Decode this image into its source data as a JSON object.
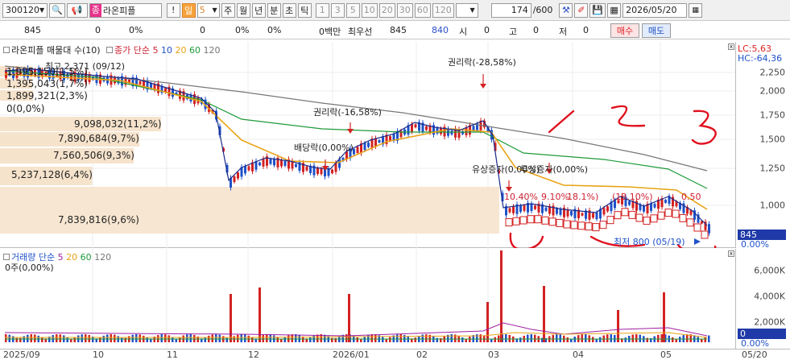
{
  "toolbar": {
    "code": "300120",
    "stock_tag": "종",
    "stock_name": "라온피플",
    "exclaim": "!",
    "period_sel": "일",
    "period_num": "5",
    "periods": [
      "주",
      "월",
      "년",
      "분",
      "초",
      "틱"
    ],
    "intervals": [
      "1",
      "3",
      "5",
      "10",
      "20",
      "30",
      "60",
      "120"
    ],
    "count": "174",
    "count_total": "/600",
    "date": "2026/05/20"
  },
  "quote": {
    "v1": "845",
    "v2": "0",
    "v3": "0%",
    "v4": "0",
    "v5": "0%",
    "v6": "0%",
    "money": "0백만",
    "best_label": "최우선",
    "best1": "845",
    "best2": "840",
    "o_label": "시",
    "o": "0",
    "h_label": "고",
    "h": "0",
    "l_label": "저",
    "l": "0",
    "buy": "매수",
    "sell": "매도"
  },
  "price_pane": {
    "legend_main": "라온피플 매물대 수(10)",
    "legend_ma": "종가 단순",
    "ma_periods": [
      "5",
      "10",
      "20",
      "60",
      "120"
    ],
    "lc": "LC:5,63",
    "hc": "HC:-64,36",
    "high_label": "최고 2,371 (09/12)",
    "low_label": "최저 800 (05/19)",
    "ann_rights1": "권리락(-28,58%)",
    "ann_rights2": "권리락(-16,58%)",
    "ann_div": "배당락(0,00%)",
    "ann_cap": "유상증자(0,00%)",
    "ann_bonus": "무상증자(0,00%)",
    "b_label_1": "10.40%",
    "b_label_2": "9.10%",
    "b_label_3": "18.1%)",
    "b_label_4": "(13.10%)",
    "b_label_5": "0.50",
    "price_last": "845",
    "price_pct": "0.00%",
    "y_ticks": [
      "2,250",
      "2,000",
      "1,750",
      "1,500",
      "1,250",
      "1,000"
    ],
    "volume_profile": [
      {
        "label": "1,995,150(1,5%)",
        "value": 1995150,
        "pct": 1.5
      },
      {
        "label": "1,395,043(1,7%)",
        "value": 1395043,
        "pct": 1.7
      },
      {
        "label": "1,899,321(2,3%)",
        "value": 1899321,
        "pct": 2.3
      },
      {
        "label": "0(0,0%)",
        "value": 0,
        "pct": 0.0
      },
      {
        "label": "9,098,032(11,2%)",
        "value": 9098032,
        "pct": 11.2
      },
      {
        "label": "7,890,684(9,7%)",
        "value": 7890684,
        "pct": 9.7
      },
      {
        "label": "7,560,506(9,3%)",
        "value": 7560506,
        "pct": 9.3
      },
      {
        "label": "5,237,128(6,4%)",
        "value": 5237128,
        "pct": 6.4
      },
      {
        "label": "7,839,816(9,6%)",
        "value": 7839816,
        "pct": 9.6
      }
    ]
  },
  "volume_pane": {
    "legend_main": "거래량",
    "legend_ma": "단순",
    "ma_periods": [
      "5",
      "20",
      "60",
      "120"
    ],
    "readout": "0주(0,00%)",
    "y_ticks": [
      "6,000K",
      "4,000K",
      "2,000K"
    ],
    "last": "0",
    "last_pct": "0.00%"
  },
  "x_axis": {
    "labels": [
      "2025/09",
      "10",
      "11",
      "12",
      "2026/01",
      "02",
      "03",
      "04",
      "05",
      "05/20"
    ]
  },
  "colors": {
    "up": "#d32222",
    "down": "#1f52c8",
    "ma5": "#1a2a8a",
    "ma20": "#e8a316",
    "ma60": "#1f9a3a",
    "ma120": "#777777",
    "profile": "#f6e3cc",
    "scribble": "#e0101e"
  }
}
